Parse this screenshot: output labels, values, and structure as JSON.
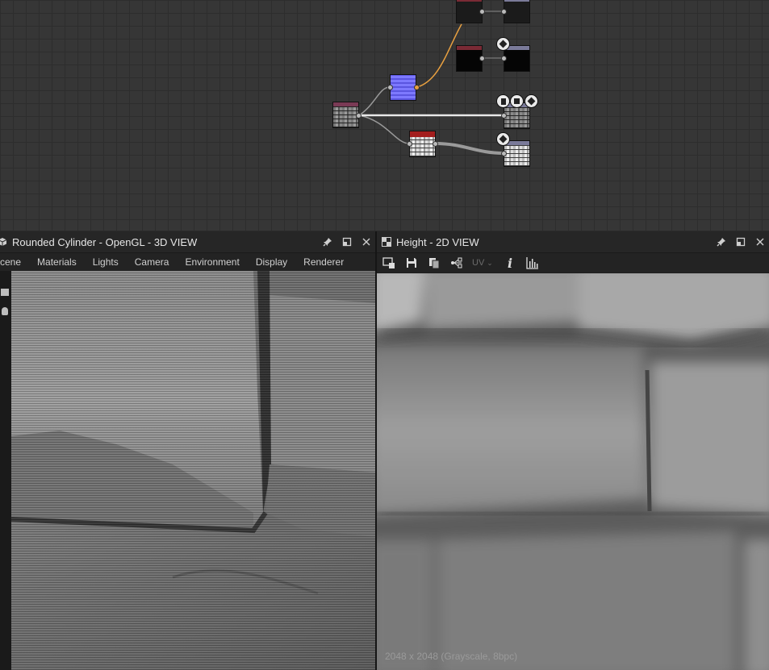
{
  "panel3d": {
    "title": "Rounded Cylinder - OpenGL - 3D VIEW",
    "menu": [
      "cene",
      "Materials",
      "Lights",
      "Camera",
      "Environment",
      "Display",
      "Renderer"
    ]
  },
  "panel2d": {
    "title": "Height - 2D VIEW",
    "uv_label": "UV",
    "info_label": "i",
    "image_info": "2048 x 2048 (Grayscale, 8bpc)"
  },
  "icons": {
    "pin": "pin-icon",
    "maximize": "maximize-icon",
    "close": "close-icon"
  },
  "colors": {
    "node_header_red": "#7a2a35",
    "node_header_output": "#7a7a99",
    "wire_orange": "#e8a040",
    "wire_white": "#e8e8e8"
  }
}
